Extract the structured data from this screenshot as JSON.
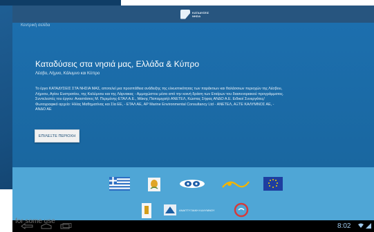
{
  "app": {
    "logo_text_1": "ΚΑΤΑΔΥΣΕΙΣ",
    "logo_text_2": "ΝΗΣΙΑ"
  },
  "breadcrumb": "Κεντρική σελίδα",
  "main": {
    "title": "Καταδύσεις στα νησιά μας, Ελλάδα & Κύπρο",
    "subtitle": "Λέσβο, Λήμνο, Κάλυμνο και Κύπρο",
    "description": "Το έργο ΚΑΤΑΔΥΣΕΙΣ ΣΤΑ ΝΗΣΙΑ ΜΑΣ, αποτελεί μια προσπάθεια ανάδειξης της ελκυστικότητας των παράκτιων και θαλάσσιων περιοχών της Λέσβου, Λήμνου, Αγίου Ευστρατίου, της Καλύμνου και της Λάρνακας - Αμμοχώστου μέσα από την κοινή δράση των Εταίρων του διασυνοριακού προγράμματος. Συντελεστές του έργου: Αναστάσιος Μ. Περιμένης-ΕΤΑΛ Α.Ε., Μάκης Παπαμιχαήλ ΑΝΕΤΕΛ, Κώστας Σήφας ΑΝΔΟ Α.Ε. Ειδικοί Συνεργάτες/Φωτογραφικό αρχείο: Ηλίας Μαθηματίνας και Σία ΕΕ, - ΕΤΑΛ ΑΕ, AP Marine Environmental Consultancy Ltd - ΑΝΕΤΕΛ, ΑΞΤΕ ΚΑΛΥΜΝΟΣ ΑΕ, - ΑΝΔΟ ΑΕ",
    "button_label": "ΕΠΙΛΕΞΤΕ ΠΕΡΙΟΧΗ"
  },
  "footer": {
    "partner_3": "ΑΝΑΠΤΥΞΙΑΚΗ ΚΑΛΥΜΝΟΥ"
  },
  "system_bar": {
    "overlay_text": "for some use",
    "time": "8:02"
  },
  "colors": {
    "screen_bg": "#1b6aa4",
    "topbar": "#27557f",
    "footer": "#4fa6d6",
    "button_bg": "#f1f1f1"
  }
}
